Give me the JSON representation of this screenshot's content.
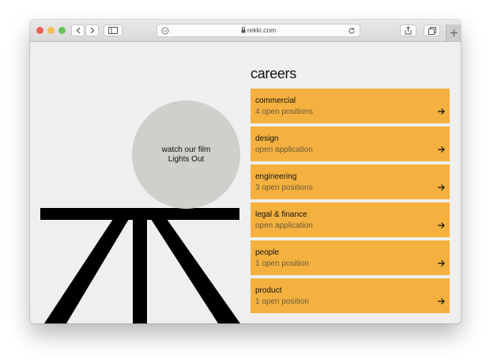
{
  "browser": {
    "domain": "rekki.com"
  },
  "hero": {
    "film_line1": "watch our film",
    "film_line2": "Lights Out"
  },
  "careers": {
    "title": "careers",
    "items": [
      {
        "name": "commercial",
        "status": "4 open positions"
      },
      {
        "name": "design",
        "status": "open application"
      },
      {
        "name": "engineering",
        "status": "3 open positions"
      },
      {
        "name": "legal & finance",
        "status": "open application"
      },
      {
        "name": "people",
        "status": "1 open position"
      },
      {
        "name": "product",
        "status": "1 open position"
      }
    ]
  },
  "colors": {
    "accent": "#f4b13f",
    "page_background": "#efefef",
    "circle": "#d1cfcc"
  },
  "icons": [
    "back-icon",
    "forward-icon",
    "sidebar-icon",
    "privacy-icon",
    "lock-icon",
    "reload-icon",
    "share-icon",
    "tabs-icon",
    "new-tab-icon",
    "arrow-right-icon"
  ]
}
